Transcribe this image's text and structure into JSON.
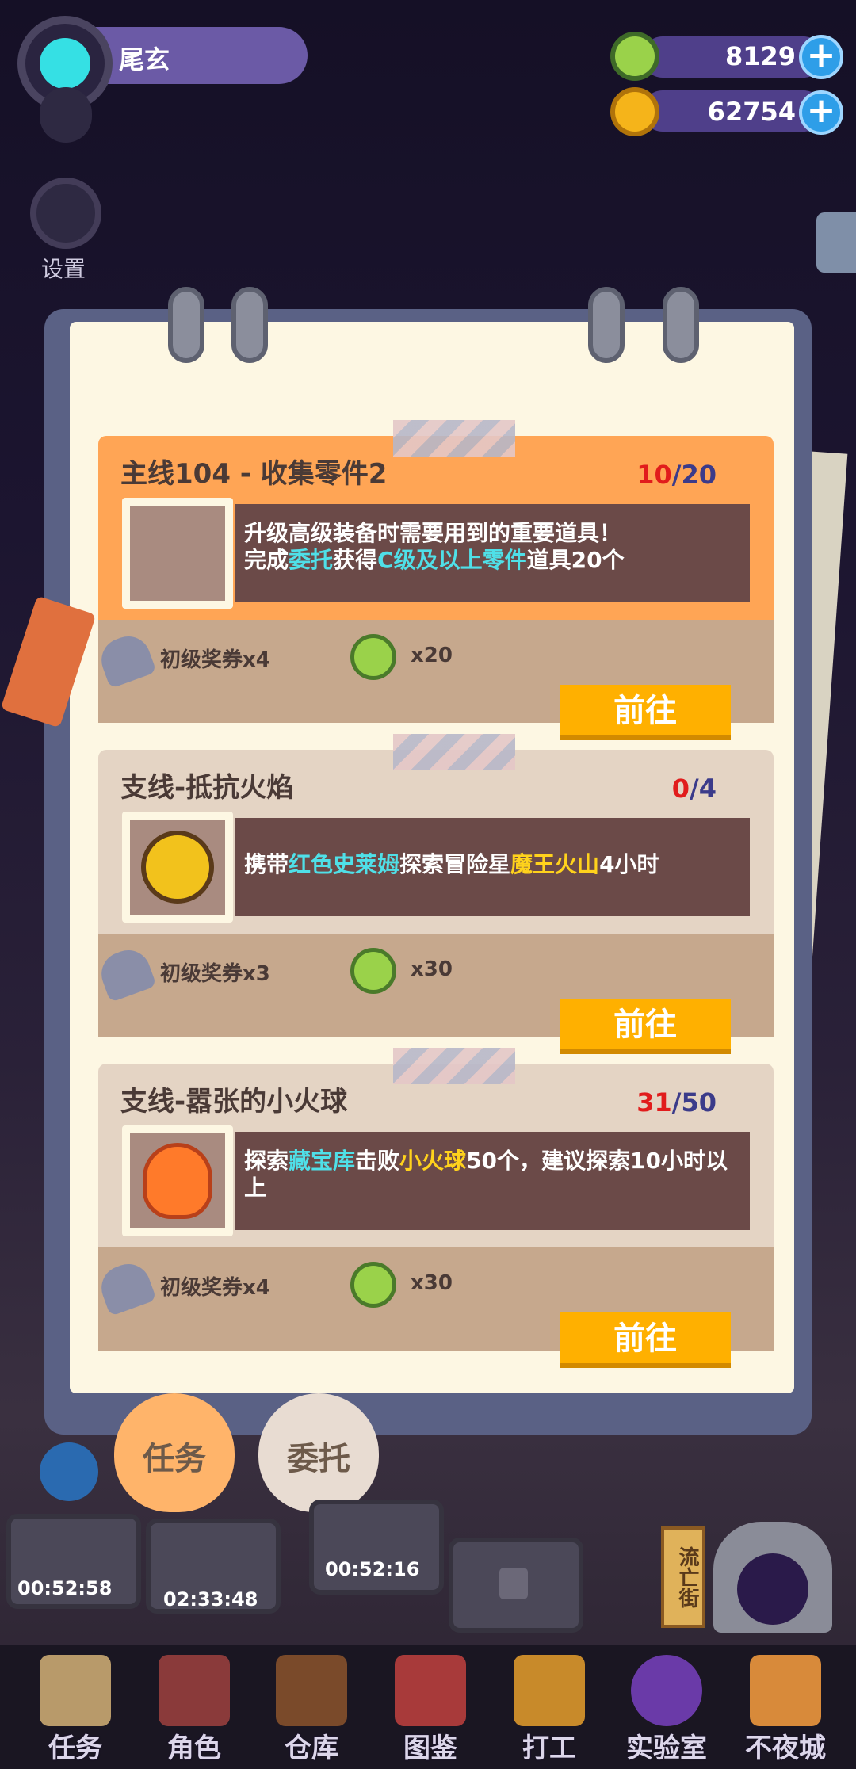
{
  "player": {
    "name": "尾玄"
  },
  "currency": [
    {
      "value": "8129",
      "icon": "green-coin-icon",
      "color": "#9ad24a"
    },
    {
      "value": "62754",
      "icon": "planet-coin-icon",
      "color": "#f5b41a"
    }
  ],
  "side": {
    "settings_label": "设置"
  },
  "quests": [
    {
      "title": "主线104 - 收集零件2",
      "progress_current": "10",
      "progress_total": "/20",
      "desc_line1": "升级高级装备时需要用到的重要道具！",
      "desc_parts": [
        "完成",
        "委托",
        "获得",
        "C级及以上零件",
        "道具20个"
      ],
      "reward_ticket": "初级奖券x4",
      "reward_coin": "x20",
      "button": "前往",
      "thumb_icon": "mystery-paper-icon",
      "head_color": "#ffa555"
    },
    {
      "title": "支线-抵抗火焰",
      "progress_current": "0",
      "progress_total": "/4",
      "desc_parts": [
        "携带",
        "红色史莱姆",
        "探索冒险星",
        "魔王火山",
        "4小时"
      ],
      "reward_ticket": "初级奖券x3",
      "reward_coin": "x30",
      "button": "前往",
      "thumb_icon": "fire-resist-medal-icon",
      "head_color": "#e4d4c4"
    },
    {
      "title": "支线-嚣张的小火球",
      "progress_current": "31",
      "progress_total": "/50",
      "desc_parts": [
        "探索",
        "藏宝库",
        "击败",
        "小火球",
        "50个，建议探索10小时以上"
      ],
      "reward_ticket": "初级奖券x4",
      "reward_coin": "x30",
      "button": "前往",
      "thumb_icon": "fireball-icon",
      "head_color": "#e4d4c4"
    }
  ],
  "tabs": [
    {
      "label": "任务",
      "active": true
    },
    {
      "label": "委托",
      "active": false
    }
  ],
  "timers": [
    "00:52:58",
    "02:33:48",
    "00:52:16"
  ],
  "street_sign": "流亡街",
  "nav": [
    {
      "label": "任务",
      "icon": "task-board-icon"
    },
    {
      "label": "角色",
      "icon": "character-icon"
    },
    {
      "label": "仓库",
      "icon": "warehouse-chest-icon"
    },
    {
      "label": "图鉴",
      "icon": "collection-book-icon"
    },
    {
      "label": "打工",
      "icon": "work-tv-icon"
    },
    {
      "label": "实验室",
      "icon": "lab-flask-icon"
    },
    {
      "label": "不夜城",
      "icon": "night-city-cat-icon"
    }
  ]
}
